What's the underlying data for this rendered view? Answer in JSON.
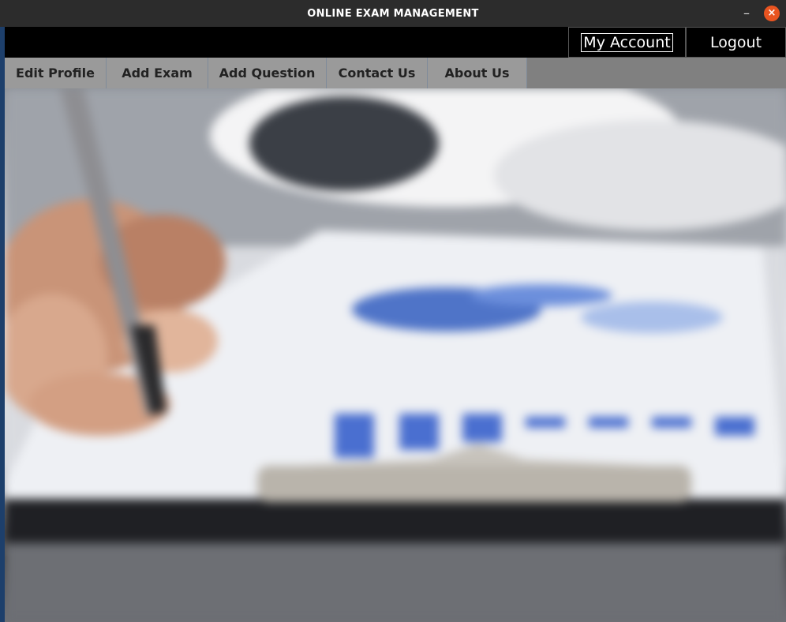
{
  "window": {
    "title": "ONLINE EXAM MANAGEMENT",
    "minimize_glyph": "–",
    "close_glyph": "×"
  },
  "topbar": {
    "my_account_label": "My Account",
    "logout_label": "Logout"
  },
  "nav": {
    "items": [
      {
        "label": "Edit Profile"
      },
      {
        "label": "Add Exam"
      },
      {
        "label": "Add Question"
      },
      {
        "label": "Contact Us"
      },
      {
        "label": "About Us"
      }
    ]
  },
  "hero": {
    "subject": "hand-writing-on-clipboard-with-charts"
  },
  "colors": {
    "titlebar": "#2c2c2c",
    "topbar": "#000000",
    "navbar": "#808080",
    "nav_item": "#9a9a9a",
    "close_button": "#e95420"
  }
}
